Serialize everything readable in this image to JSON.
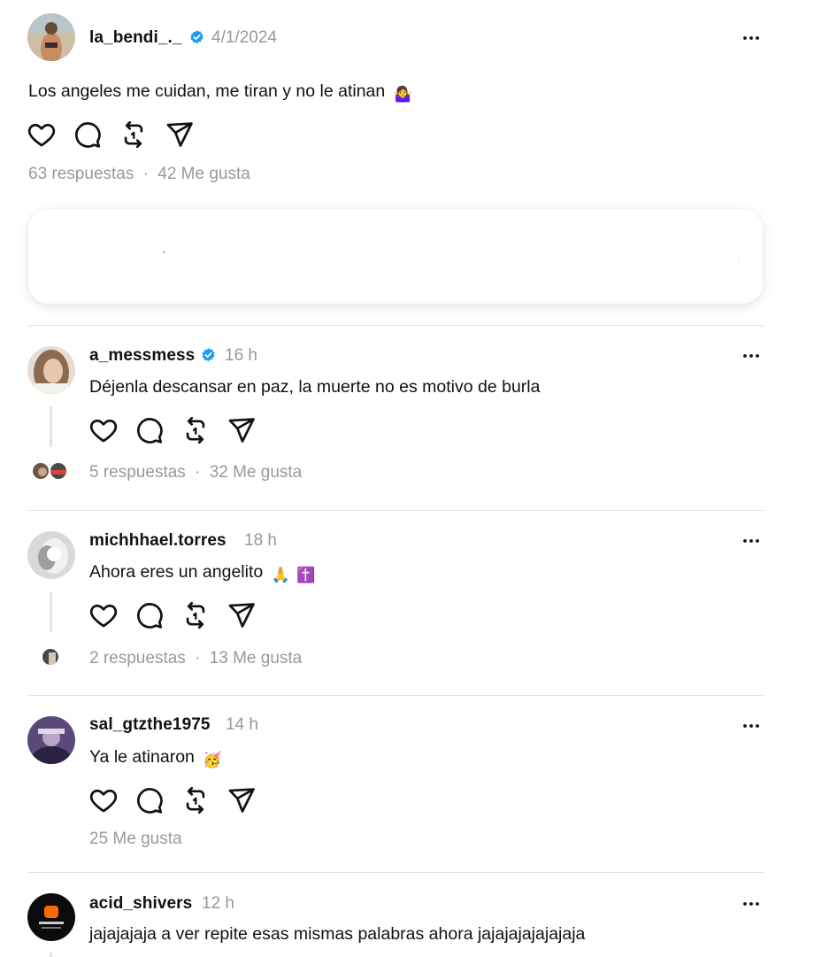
{
  "main_post": {
    "username": "la_bendi_._",
    "verified": true,
    "date": "4/1/2024",
    "text": "Los angeles me cuidan, me tiran y no le atinan",
    "emoji": "🤷‍♀️",
    "replies": "63 respuestas",
    "separator": "·",
    "likes": "42 Me gusta"
  },
  "replies": [
    {
      "username": "a_messmess",
      "verified": true,
      "time": "16 h",
      "text": "Déjenla descansar en paz, la muerte no es motivo de burla",
      "replies": "5 respuestas",
      "separator": "·",
      "likes": "32 Me gusta"
    },
    {
      "username": "michhhael.torres",
      "verified": false,
      "time": "18 h",
      "text": "Ahora eres un angelito",
      "emojis": [
        "🙏",
        "✝️"
      ],
      "replies": "2 respuestas",
      "separator": "·",
      "likes": "13 Me gusta"
    },
    {
      "username": "sal_gtzthe1975",
      "verified": false,
      "time": "14 h",
      "text": "Ya le atinaron",
      "emoji": "🥳",
      "likes": "25 Me gusta"
    },
    {
      "username": "acid_shivers",
      "verified": false,
      "time": "12 h",
      "text": "jajajajaja a ver repite esas mismas palabras ahora jajajajajajajaja"
    }
  ],
  "icons": {
    "like": "heart-icon",
    "reply": "comment-icon",
    "repost": "repost-icon",
    "share": "send-icon",
    "more": "more-options-icon",
    "verified": "verified-badge-icon"
  },
  "colors": {
    "verified": "#1d9bf0",
    "muted_text": "#999999",
    "divider": "#dedede"
  }
}
